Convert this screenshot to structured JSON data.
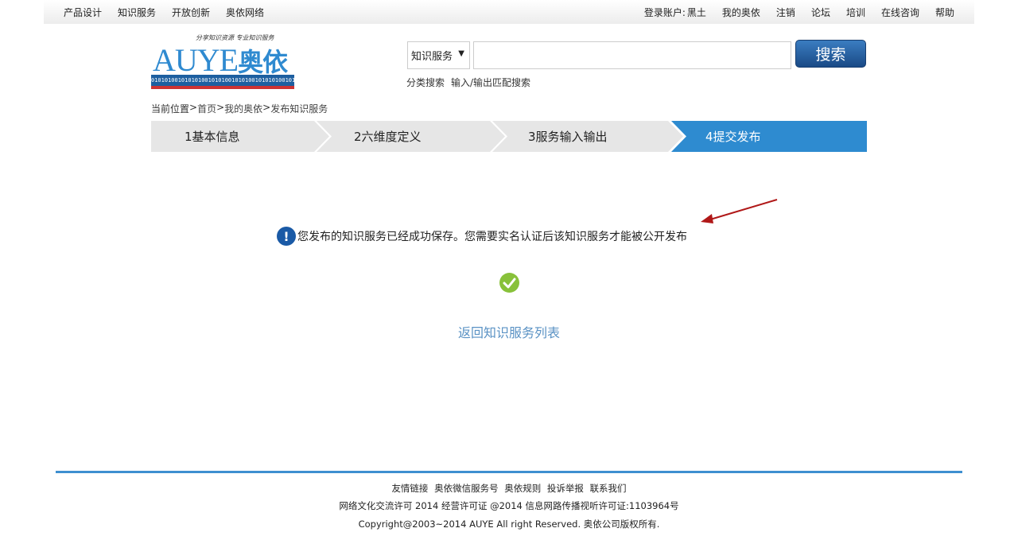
{
  "topbar": {
    "left_items": [
      "产品设计",
      "知识服务",
      "开放创新",
      "奥依网络"
    ],
    "account_label": "登录账户:",
    "account_name": "黑土",
    "right_items": [
      "我的奥依",
      "注销",
      "论坛",
      "培训",
      "在线咨询",
      "帮助"
    ]
  },
  "logo": {
    "slogan": "分享知识资源 专业知识服务",
    "brand_en": "AUYE",
    "brand_cn": "奥依",
    "binary": "0101010010101010010101001010100101010100101010010101"
  },
  "search": {
    "category": "知识服务",
    "input_value": "",
    "button_label": "搜索",
    "links": [
      "分类搜索",
      "输入/输出匹配搜索"
    ]
  },
  "breadcrumb": {
    "prefix": "当前位置",
    "items": [
      "首页",
      "我的奥依",
      "发布知识服务"
    ],
    "separator": ">"
  },
  "steps": [
    {
      "label": "1基本信息",
      "active": false
    },
    {
      "label": "2六维度定义",
      "active": false
    },
    {
      "label": "3服务输入输出",
      "active": false
    },
    {
      "label": "4提交发布",
      "active": true
    }
  ],
  "colors": {
    "step_inactive": "#e6e6e6",
    "step_active": "#2e8bd0",
    "accent": "#1a5aa6",
    "success": "#88c13a",
    "link": "#5a92c4",
    "footer_line": "#3e8fd0"
  },
  "message": {
    "text": "您发布的知识服务已经成功保存。您需要实名认证后该知识服务才能被公开发布",
    "icon": "info-icon"
  },
  "return_link": "返回知识服务列表",
  "footer": {
    "links": [
      "友情链接",
      "奥依微信服务号",
      "奥依规则",
      "投诉举报",
      "联系我们"
    ],
    "license": "网络文化交流许可 2014 经营许可证 @2014 信息网路传播视听许可证:1103964号",
    "copyright": "Copyright@2003~2014 AUYE All right Reserved. 奥依公司版权所有."
  }
}
